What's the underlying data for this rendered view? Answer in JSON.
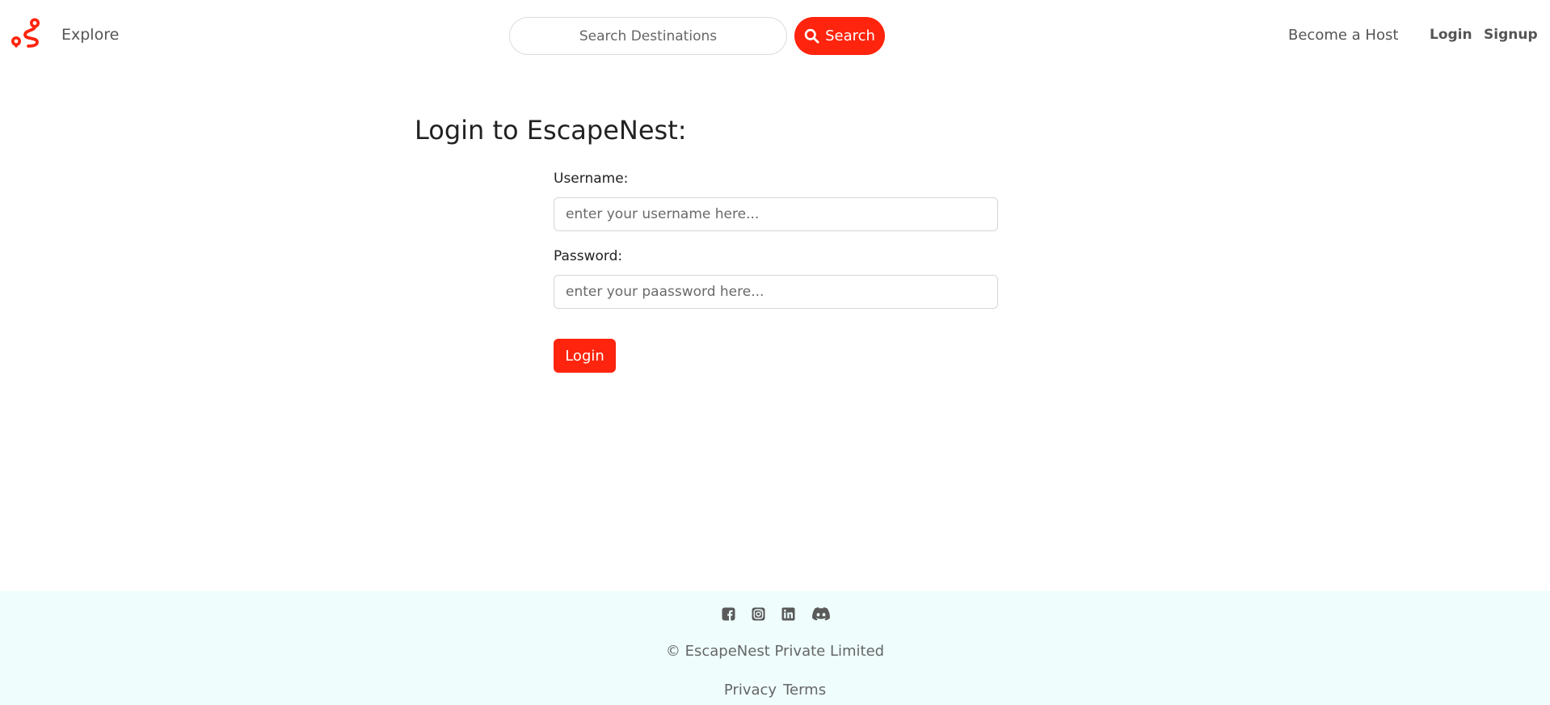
{
  "brand": {
    "accent_color": "#fe240d",
    "logo_icon": "route-icon"
  },
  "navbar": {
    "explore_label": "Explore",
    "search_placeholder": "Search Destinations",
    "search_button_label": "Search",
    "search_icon": "magnifier-icon",
    "become_host_label": "Become a Host",
    "login_label": "Login",
    "signup_label": "Signup"
  },
  "main": {
    "title": "Login to EscapeNest:",
    "username_label": "Username:",
    "username_placeholder": "enter your username here...",
    "password_label": "Password:",
    "password_placeholder": "enter your paassword here...",
    "login_button_label": "Login"
  },
  "footer": {
    "background_color": "#effdfd",
    "social_icons": [
      "facebook-icon",
      "instagram-icon",
      "linkedin-icon",
      "discord-icon"
    ],
    "copyright": "© EscapeNest Private Limited",
    "links": [
      "Privacy",
      "Terms"
    ]
  }
}
